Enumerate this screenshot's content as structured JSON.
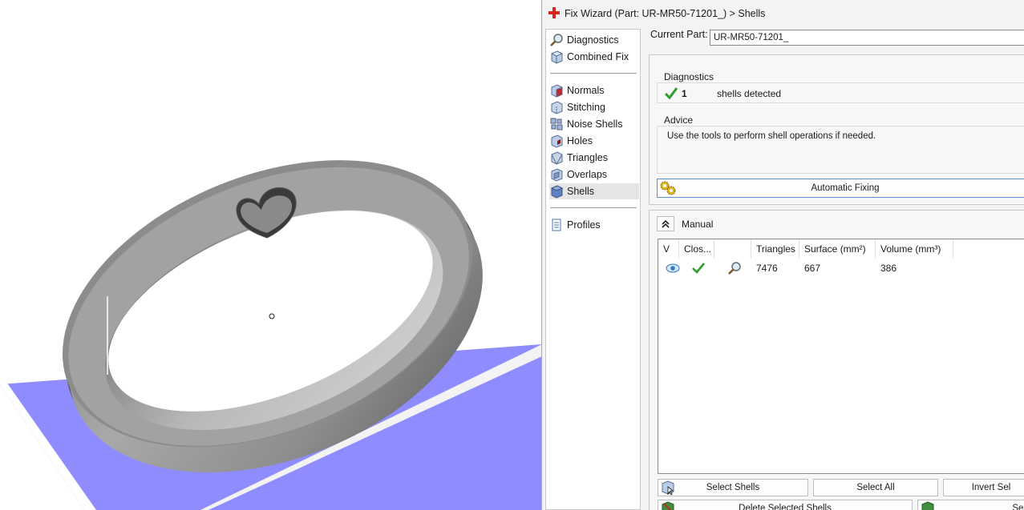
{
  "window": {
    "title": "Fix Wizard (Part: UR-MR50-71201_) > Shells"
  },
  "nav": {
    "items": [
      {
        "label": "Diagnostics",
        "icon": "magnifier-icon"
      },
      {
        "label": "Combined Fix",
        "icon": "cube-icon"
      },
      {
        "label": "Normals",
        "icon": "normals-cube-icon"
      },
      {
        "label": "Stitching",
        "icon": "stitching-cube-icon"
      },
      {
        "label": "Noise Shells",
        "icon": "noise-shells-icon"
      },
      {
        "label": "Holes",
        "icon": "holes-cube-icon"
      },
      {
        "label": "Triangles",
        "icon": "triangles-cube-icon"
      },
      {
        "label": "Overlaps",
        "icon": "overlaps-cube-icon"
      },
      {
        "label": "Shells",
        "icon": "shells-cube-icon"
      },
      {
        "label": "Profiles",
        "icon": "document-icon"
      }
    ],
    "selected": "Shells"
  },
  "current_part": {
    "label": "Current Part:",
    "value": "UR-MR50-71201_"
  },
  "diagnostics": {
    "group_title": "Diagnostics",
    "count": "1",
    "text": "shells detected",
    "status_color": "#2e9e2e"
  },
  "advice": {
    "group_title": "Advice",
    "text": "Use the tools to perform shell operations if needed."
  },
  "automatic_fixing": {
    "label": "Automatic Fixing"
  },
  "manual": {
    "label": "Manual",
    "table": {
      "columns": [
        "V",
        "Clos...",
        "",
        "Triangles",
        "Surface (mm²)",
        "Volume (mm³)"
      ],
      "rows": [
        {
          "visible_icon": "eye-icon",
          "closed_icon": "checkmark-icon",
          "zoom_icon": "magnifier-icon",
          "triangles": "7476",
          "surface": "667",
          "volume": "386"
        }
      ]
    },
    "buttons": {
      "select_shells": "Select Shells",
      "select_all": "Select All",
      "invert_sel": "Invert Sel",
      "delete_selected": "Delete Selected Shells",
      "separate": "Separ"
    }
  },
  "colors": {
    "ground_plane": "#8f8cff",
    "ring_metal": "#9a9a9a",
    "accent_blue": "#5b8fd0"
  }
}
